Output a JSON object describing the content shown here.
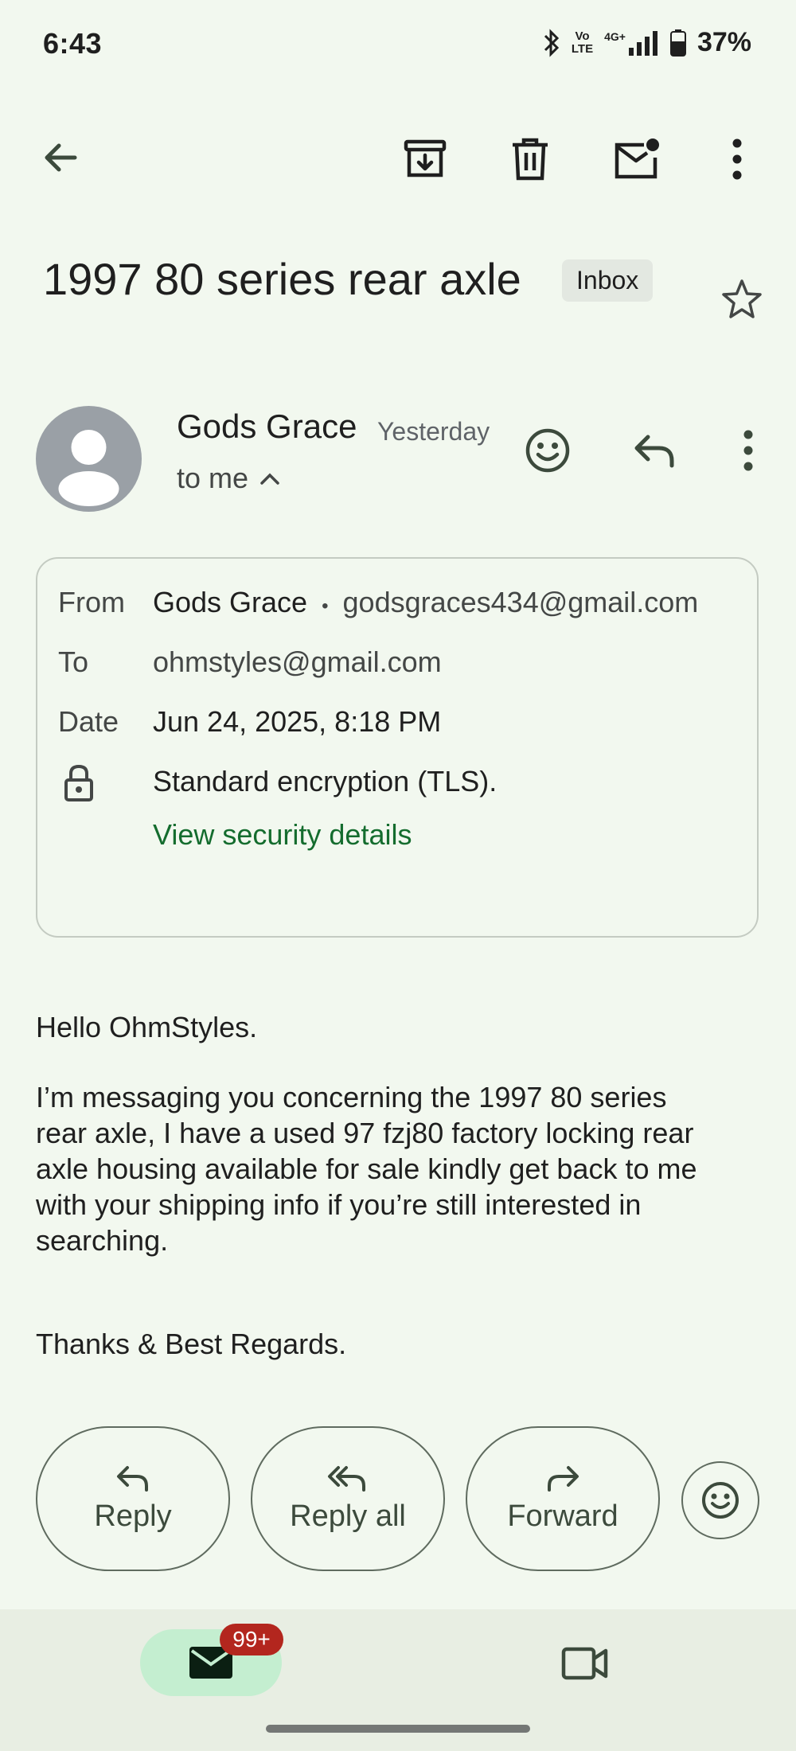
{
  "status_bar": {
    "time": "6:43",
    "network_top": "Vo",
    "network_bottom": "LTE",
    "signal_label": "4G+",
    "battery": "37%"
  },
  "toolbar": {
    "icons": [
      "back-arrow-icon",
      "archive-icon",
      "delete-icon",
      "mark-unread-icon",
      "more-vert-icon"
    ]
  },
  "email": {
    "subject": "1997 80 series rear axle",
    "label": "Inbox",
    "sender_name": "Gods Grace",
    "sent_time": "Yesterday",
    "recipient_summary": "to me",
    "details": {
      "from_label": "From",
      "from_name": "Gods Grace",
      "from_separator": "•",
      "from_email": "godsgraces434@gmail.com",
      "to_label": "To",
      "to_email": "ohmstyles@gmail.com",
      "date_label": "Date",
      "date_value": "Jun 24, 2025, 8:18 PM",
      "encryption": "Standard encryption (TLS).",
      "security_link": "View security details"
    },
    "body": {
      "greeting": "Hello OhmStyles.",
      "paragraph_lines": [
        "I’m messaging you concerning the 1997 80 series",
        "rear axle, I have a used 97 fzj80 factory locking rear",
        "axle housing available for sale kindly get back to me",
        "with your shipping info if you’re still interested in",
        "searching."
      ],
      "signoff": "Thanks & Best Regards."
    }
  },
  "actions": {
    "reply": "Reply",
    "reply_all": "Reply all",
    "forward": "Forward"
  },
  "bottom_nav": {
    "mail_badge": "99+"
  },
  "colors": {
    "background": "#f2f8ef",
    "link_green": "#146c2e",
    "badge_red": "#b3261e",
    "active_tab": "#c4eed0"
  }
}
